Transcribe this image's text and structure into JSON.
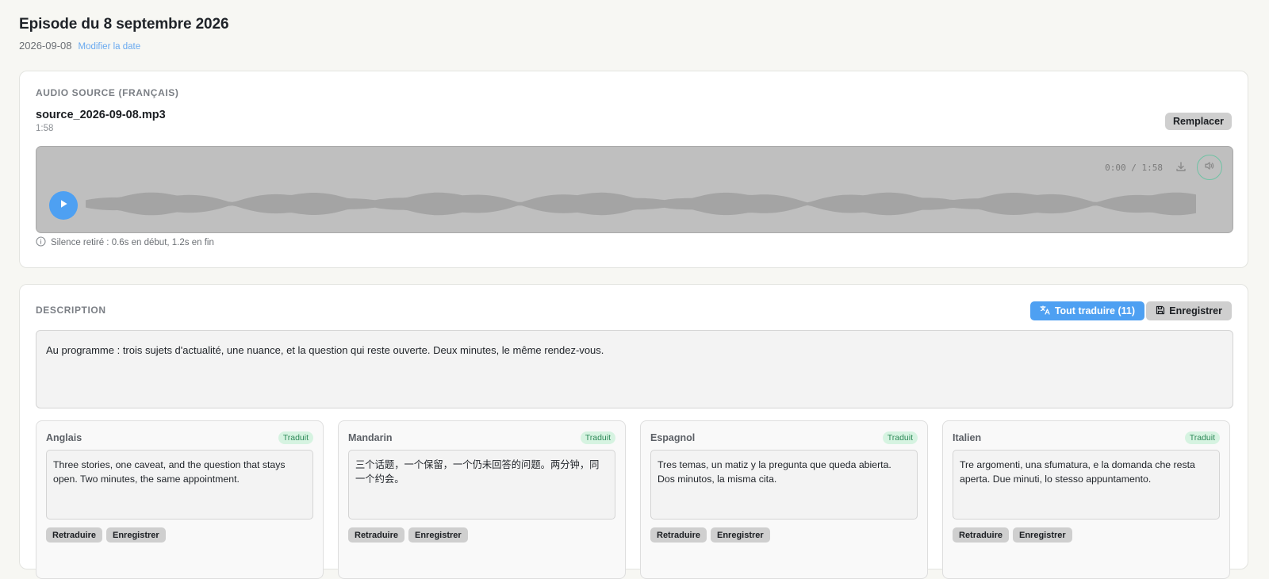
{
  "episode": {
    "title": "Episode du 8 septembre 2026",
    "date": "2026-09-08",
    "edit_date_label": "Modifier la date"
  },
  "audio": {
    "section_label": "AUDIO SOURCE (FRANÇAIS)",
    "filename": "source_2026-09-08.mp3",
    "duration": "1:58",
    "replace_label": "Remplacer",
    "player": {
      "timecode": "0:00 / 1:58",
      "progress": 0
    },
    "silence_note": "Silence retiré : 0.6s en début, 1.2s en fin"
  },
  "description": {
    "section_label": "DESCRIPTION",
    "translate_all_label": "Tout traduire (11)",
    "save_label": "Enregistrer",
    "text": "Au programme : trois sujets d'actualité, une nuance, et la question qui reste ouverte. Deux minutes, le même rendez-vous."
  },
  "translations": [
    {
      "language": "Anglais",
      "status": "Traduit",
      "text": "Three stories, one caveat, and the question that stays open. Two minutes, the same appointment.",
      "retranslate_label": "Retraduire",
      "save_label": "Enregistrer"
    },
    {
      "language": "Mandarin",
      "status": "Traduit",
      "text": "三个话题，一个保留，一个仍未回答的问题。两分钟，同一个约会。",
      "retranslate_label": "Retraduire",
      "save_label": "Enregistrer"
    },
    {
      "language": "Espagnol",
      "status": "Traduit",
      "text": "Tres temas, un matiz y la pregunta que queda abierta. Dos minutos, la misma cita.",
      "retranslate_label": "Retraduire",
      "save_label": "Enregistrer"
    },
    {
      "language": "Italien",
      "status": "Traduit",
      "text": "Tre argomenti, una sfumatura, e la domanda che resta aperta. Due minuti, lo stesso appuntamento.",
      "retranslate_label": "Retraduire",
      "save_label": "Enregistrer"
    }
  ],
  "colors": {
    "accent": "#4ea0f2",
    "badge_bg": "#d6f3e1",
    "badge_text": "#2f8a59",
    "volume_ring": "#6fc2a4"
  },
  "icons": {
    "play": "play-icon",
    "download": "download-icon",
    "volume": "volume-icon",
    "info": "info-icon",
    "translate": "translate-icon",
    "save": "save-icon"
  }
}
